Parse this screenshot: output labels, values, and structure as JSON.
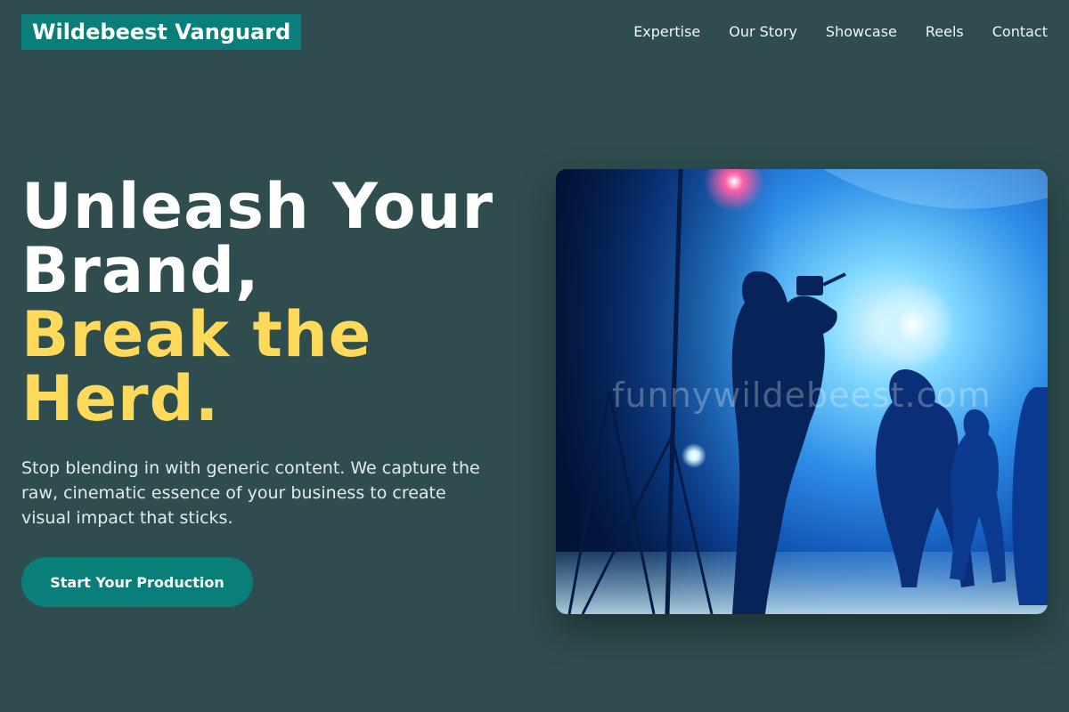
{
  "brand": {
    "name": "Wildebeest Vanguard"
  },
  "nav": {
    "items": [
      {
        "label": "Expertise"
      },
      {
        "label": "Our Story"
      },
      {
        "label": "Showcase"
      },
      {
        "label": "Reels"
      },
      {
        "label": "Contact"
      }
    ]
  },
  "hero": {
    "headline_line1": "Unleash Your",
    "headline_line2": "Brand,",
    "headline_line3": "Break the",
    "headline_line4": "Herd.",
    "subtitle": "Stop blending in with generic content. We capture the raw, cinematic essence of your business to create visual impact that sticks.",
    "cta_label": "Start Your Production"
  },
  "media": {
    "watermark": "funnywildebeest.com",
    "alt": "Film crew silhouettes shooting on a blue-lit stage"
  },
  "colors": {
    "background": "#2f4d4e",
    "accent": "#0a7f7a",
    "highlight": "#ffd95a",
    "text": "#ffffff"
  }
}
